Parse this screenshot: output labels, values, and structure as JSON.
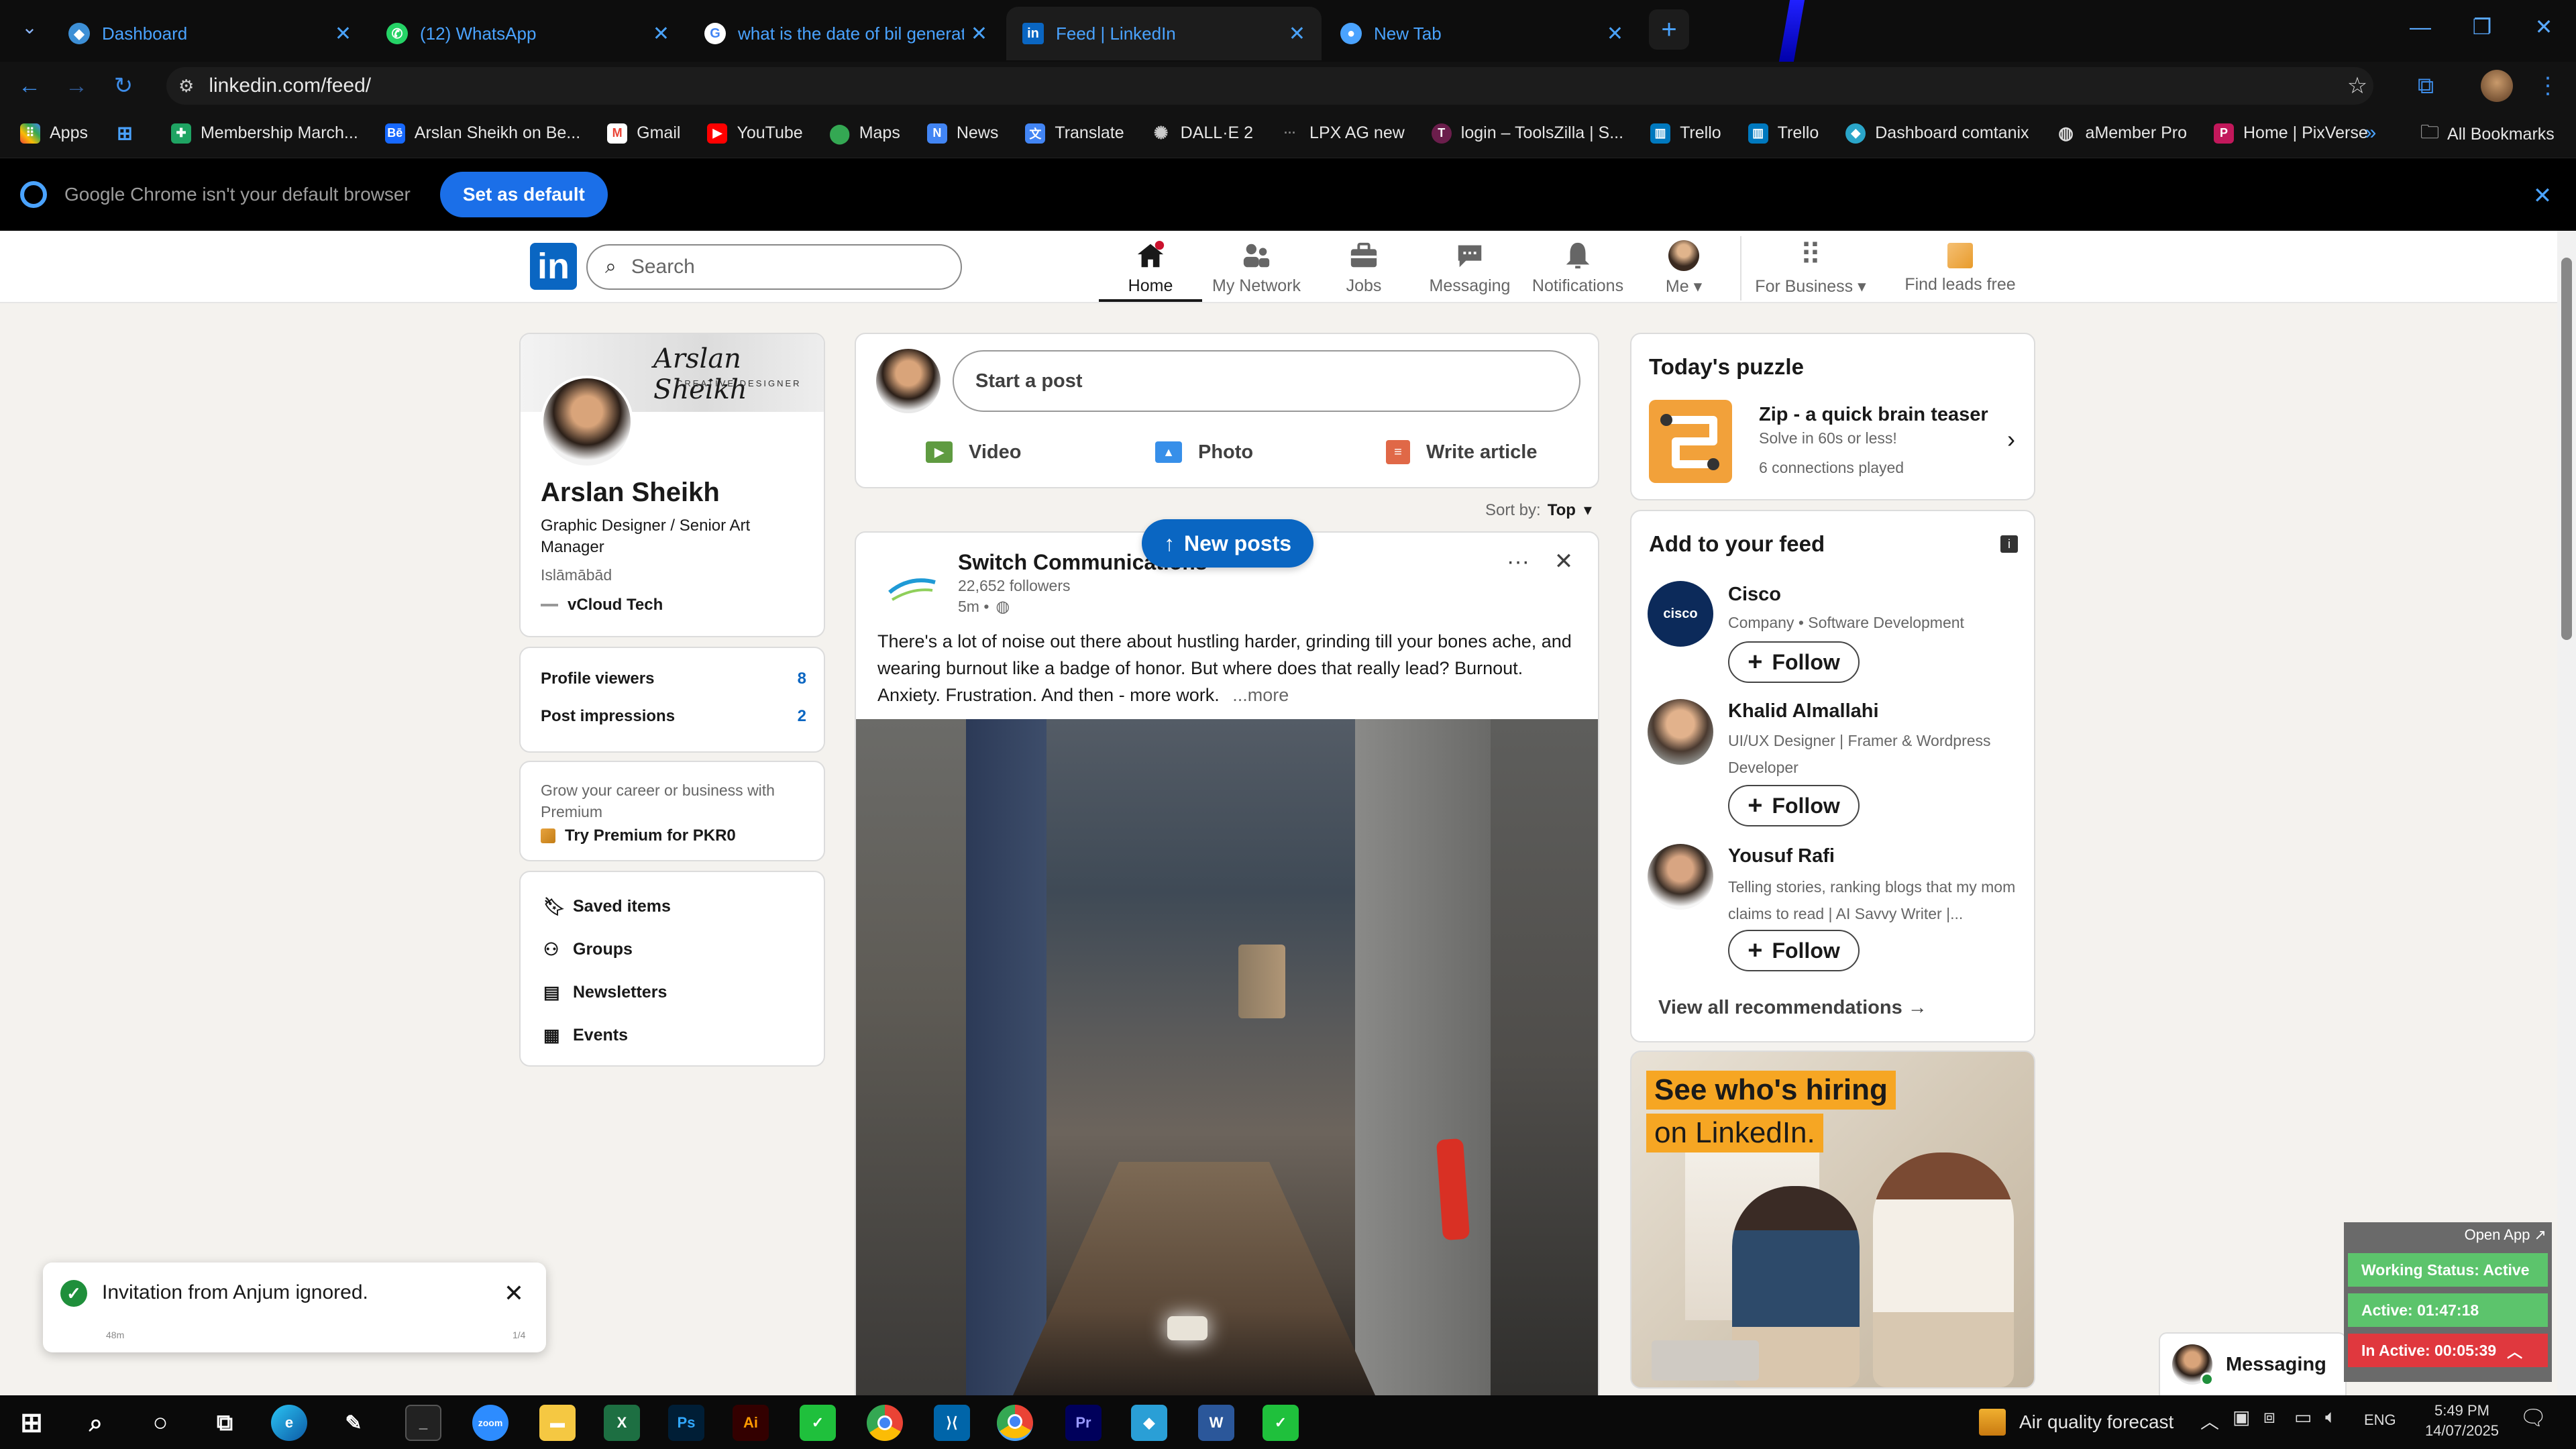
{
  "browser": {
    "tabs": [
      {
        "label": "Dashboard",
        "icon": "dashboard-icon"
      },
      {
        "label": "(12) WhatsApp",
        "icon": "whatsapp-icon"
      },
      {
        "label": "what is the date of bil generatio",
        "icon": "google-icon"
      },
      {
        "label": "Feed | LinkedIn",
        "icon": "linkedin-icon"
      },
      {
        "label": "New Tab",
        "icon": "chrome-icon"
      }
    ],
    "url": "linkedin.com/feed/",
    "bookmarks": [
      "Apps",
      "Membership March...",
      "Arslan Sheikh on Be...",
      "Gmail",
      "YouTube",
      "Maps",
      "News",
      "Translate",
      "DALL·E 2",
      "LPX AG new",
      "login – ToolsZilla | S...",
      "Trello",
      "Trello",
      "Dashboard comtanix",
      "aMember Pro",
      "Home | PixVerse"
    ],
    "all_bookmarks": "All Bookmarks",
    "default_notice": "Google Chrome isn't your default browser",
    "set_default": "Set as default"
  },
  "linkedin": {
    "logo": "in",
    "search_placeholder": "Search",
    "nav": {
      "home": "Home",
      "network": "My Network",
      "jobs": "Jobs",
      "messaging": "Messaging",
      "notifications": "Notifications",
      "me": "Me",
      "business": "For Business",
      "leads": "Find leads free"
    }
  },
  "profile": {
    "banner_sig": "Arslan Sheikh",
    "banner_sub": "CREATIVE DESIGNER",
    "name": "Arslan Sheikh",
    "headline": "Graphic Designer / Senior Art Manager",
    "location": "Islāmābād",
    "company": "vCloud Tech",
    "profile_viewers_label": "Profile viewers",
    "profile_viewers": "8",
    "post_impressions_label": "Post impressions",
    "post_impressions": "2",
    "premium_text": "Grow your career or business with Premium",
    "premium_cta": "Try Premium for PKR0",
    "links": [
      "Saved items",
      "Groups",
      "Newsletters",
      "Events"
    ]
  },
  "composer": {
    "placeholder": "Start a post",
    "video": "Video",
    "photo": "Photo",
    "article": "Write article",
    "sort_label": "Sort by:",
    "sort_value": "Top"
  },
  "post": {
    "new_posts": "New posts",
    "author": "Switch Communications",
    "followers": "22,652 followers",
    "time": "5m •",
    "text": "There's a lot of noise out there about hustling harder, grinding till your bones ache, and wearing burnout like a badge of honor. But where does that really lead? Burnout. Anxiety. Frustration. And then - more work.",
    "more": "...more"
  },
  "puzzle": {
    "heading": "Today's puzzle",
    "title": "Zip - a quick brain teaser",
    "sub": "Solve in 60s or less!",
    "played": "6 connections played"
  },
  "feed_suggestions": {
    "heading": "Add to your feed",
    "follow": "Follow",
    "items": [
      {
        "name": "Cisco",
        "desc": "Company • Software Development"
      },
      {
        "name": "Khalid Almallahi",
        "desc": "UI/UX Designer | Framer & Wordpress Developer"
      },
      {
        "name": "Yousuf Rafi",
        "desc": "Telling stories, ranking blogs that my mom claims to read | AI Savvy Writer |..."
      }
    ],
    "view_all": "View all recommendations →"
  },
  "ad": {
    "line1": "See who's hiring",
    "line2": "on LinkedIn."
  },
  "toast": {
    "message": "Invitation from Anjum ignored.",
    "time": "48m",
    "count": "1/4"
  },
  "tracker": {
    "open_app": "Open App ↗",
    "working": "Working Status: Active",
    "active": "Active: 01:47:18",
    "inactive": "In Active: 00:05:39"
  },
  "messaging_bar": "Messaging",
  "taskbar": {
    "weather": "Air quality forecast",
    "lang": "ENG",
    "time": "5:49 PM",
    "date": "14/07/2025"
  },
  "colors": {
    "linkedin_blue": "#0a66c2",
    "chrome_blue": "#1b6fe8",
    "tracker_green": "#5cc46c",
    "tracker_red": "#e0383e"
  }
}
